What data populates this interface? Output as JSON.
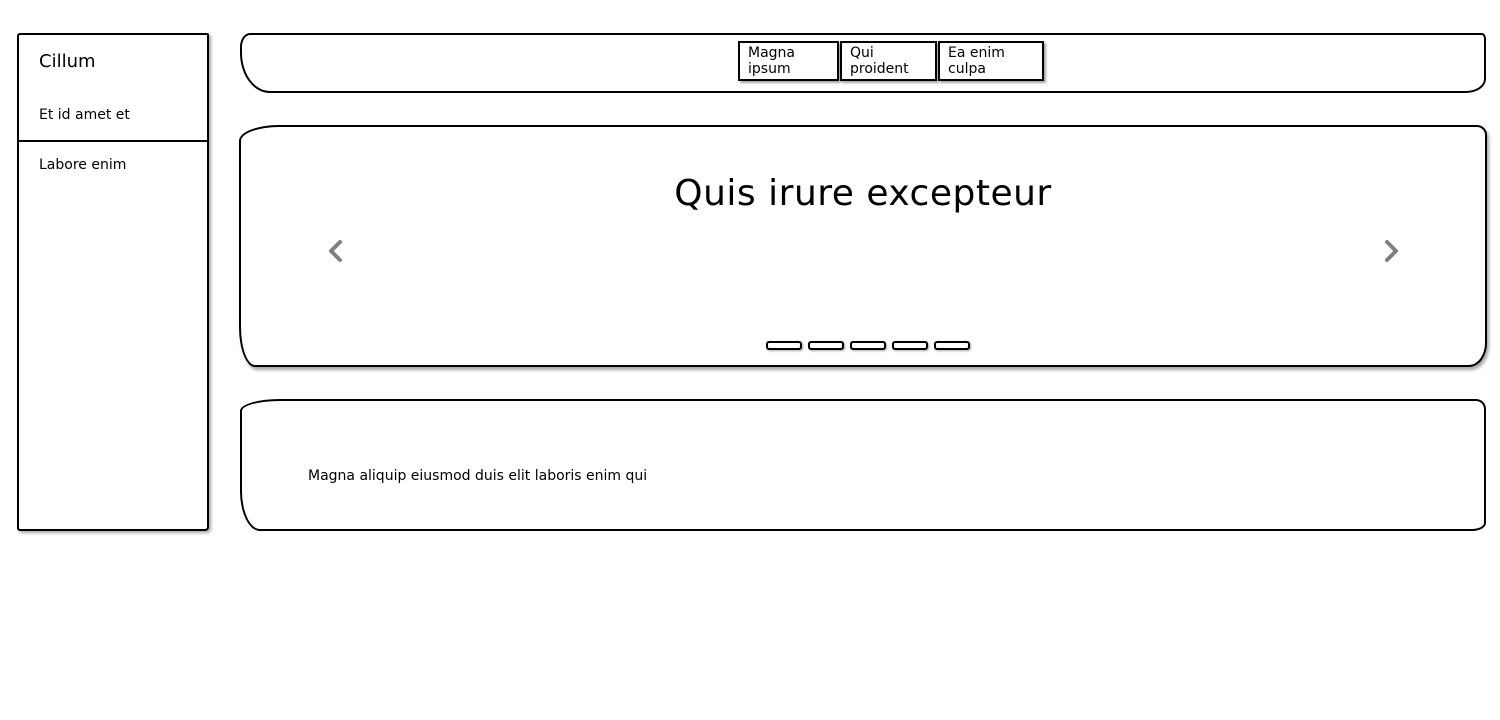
{
  "sidebar": {
    "title": "Cillum",
    "items": [
      {
        "label": "Et id amet et"
      },
      {
        "label": "Labore enim"
      }
    ]
  },
  "nav": {
    "buttons": [
      {
        "label": "Magna ipsum"
      },
      {
        "label": "Qui proident"
      },
      {
        "label": "Ea enim culpa"
      }
    ]
  },
  "carousel": {
    "title": "Quis irure excepteur",
    "prev_icon": "chevron-left-icon",
    "next_icon": "chevron-right-icon",
    "slide_count": 5,
    "arrow_color": "#808080"
  },
  "panel": {
    "text": "Magna aliquip eiusmod duis elit laboris enim qui"
  }
}
